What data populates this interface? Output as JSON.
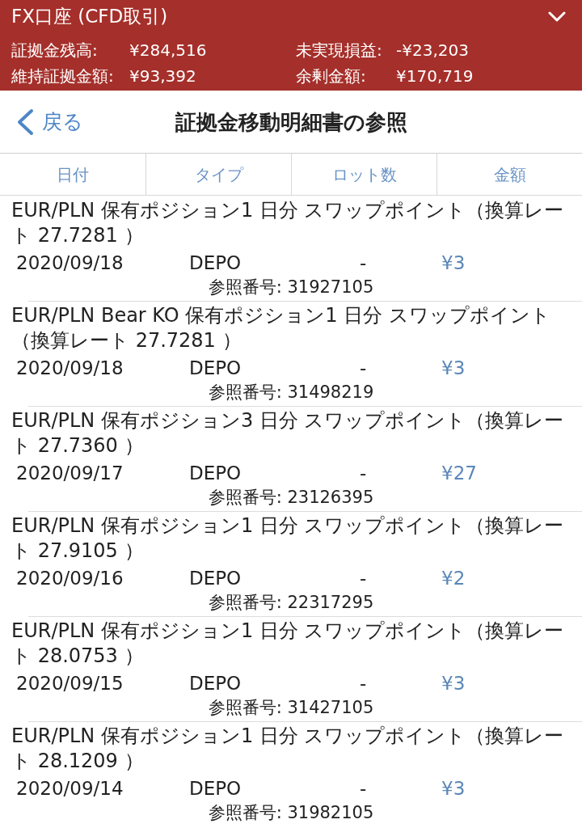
{
  "header": {
    "title": "FX口座 (CFD取引)"
  },
  "summary": [
    {
      "label": "証拠金残高:",
      "value": "¥284,516"
    },
    {
      "label": "未実現損益:",
      "value": "-¥23,203"
    },
    {
      "label": "維持証拠金額:",
      "value": "¥93,392"
    },
    {
      "label": "余剰金額:",
      "value": "¥170,719"
    }
  ],
  "nav": {
    "back": "戻る",
    "title": "証拠金移動明細書の参照"
  },
  "table": {
    "columns": [
      "日付",
      "タイプ",
      "ロット数",
      "金額"
    ],
    "rows": [
      {
        "description": "EUR/PLN 保有ポジション1 日分 スワップポイント（換算レート 27.7281 ）",
        "date": "2020/09/18",
        "type": "DEPO",
        "lots": "-",
        "amount": "¥3",
        "reference": "参照番号: 31927105"
      },
      {
        "description": "EUR/PLN Bear KO 保有ポジション1 日分 スワップポイント（換算レート 27.7281 ）",
        "date": "2020/09/18",
        "type": "DEPO",
        "lots": "-",
        "amount": "¥3",
        "reference": "参照番号: 31498219"
      },
      {
        "description": "EUR/PLN 保有ポジション3 日分 スワップポイント（換算レート 27.7360 ）",
        "date": "2020/09/17",
        "type": "DEPO",
        "lots": "-",
        "amount": "¥27",
        "reference": "参照番号: 23126395"
      },
      {
        "description": "EUR/PLN 保有ポジション1 日分 スワップポイント（換算レート 27.9105 ）",
        "date": "2020/09/16",
        "type": "DEPO",
        "lots": "-",
        "amount": "¥2",
        "reference": "参照番号: 22317295"
      },
      {
        "description": "EUR/PLN 保有ポジション1 日分 スワップポイント（換算レート 28.0753 ）",
        "date": "2020/09/15",
        "type": "DEPO",
        "lots": "-",
        "amount": "¥3",
        "reference": "参照番号: 31427105"
      },
      {
        "description": "EUR/PLN 保有ポジション1 日分 スワップポイント（換算レート 28.1209 ）",
        "date": "2020/09/14",
        "type": "DEPO",
        "lots": "-",
        "amount": "¥3",
        "reference": "参照番号: 31982105"
      }
    ]
  }
}
